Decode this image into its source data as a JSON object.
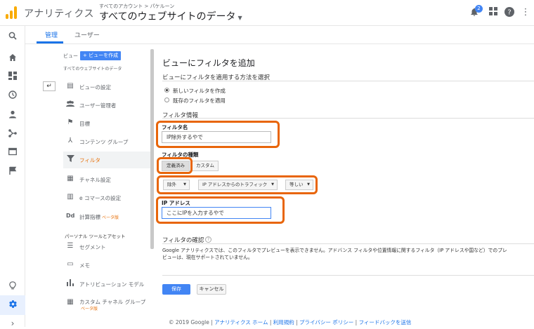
{
  "app": {
    "title": "アナリティクス",
    "breadcrumb": "すべてのアカウント > パケルーン",
    "property": "すべてのウェブサイトのデータ",
    "notification_count": "2"
  },
  "tabs": [
    {
      "label": "管理"
    },
    {
      "label": "ユーザー"
    }
  ],
  "nav": {
    "view_label": "ビュー",
    "create_view": "+ ビューを作成",
    "view_name": "すべてのウェブサイトのデータ",
    "items": [
      {
        "label": "ビューの設定",
        "icon": "document-icon"
      },
      {
        "label": "ユーザー管理者",
        "icon": "users-icon"
      },
      {
        "label": "目標",
        "icon": "flag-icon"
      },
      {
        "label": "コンテンツ グループ",
        "icon": "content-group-icon"
      },
      {
        "label": "フィルタ",
        "icon": "filter-icon"
      },
      {
        "label": "チャネル設定",
        "icon": "channel-icon"
      },
      {
        "label": "e コマースの設定",
        "icon": "cart-icon"
      },
      {
        "label": "計算指標",
        "icon": "dd-icon",
        "badge": "ベータ版"
      },
      {
        "label": "セグメント",
        "icon": "segment-icon"
      },
      {
        "label": "メモ",
        "icon": "memo-icon"
      },
      {
        "label": "アトリビューション モデル",
        "icon": "bar-chart-icon"
      },
      {
        "label": "カスタム チャネル グループ",
        "icon": "custom-channel-icon",
        "badge": "ベータ版"
      }
    ],
    "section_label": "パーソナル ツールとアセット"
  },
  "form": {
    "title": "ビューにフィルタを追加",
    "method_label": "ビューにフィルタを適用する方法を選択",
    "radio_new": "新しいフィルタを作成",
    "radio_existing": "既存のフィルタを適用",
    "info_label": "フィルタ情報",
    "name_label": "フィルタ名",
    "name_value": "IP除外するやで",
    "type_label": "フィルタの種類",
    "type_predefined": "定義済み",
    "type_custom": "カスタム",
    "dd_exclude": "除外",
    "dd_traffic": "IP アドレスからのトラフィック",
    "dd_equal": "等しい",
    "ip_label": "IP アドレス",
    "ip_value": "ここにIPを入力するやで",
    "confirm_label": "フィルタの確認",
    "confirm_text_1": "Google アナリティクスでは、このフィルタでプレビューを表示できません。アドバンス フィルタや位置情報に関するフィルタ（IP アドレスや国など）でのプレ",
    "confirm_text_2": "ビューは、現在サポートされていません。",
    "save": "保存",
    "cancel": "キャンセル"
  },
  "footer": {
    "copyright": "© 2019 Google | ",
    "link_home": "アナリティクス ホーム",
    "sep": " | ",
    "link_terms": "利用規約",
    "link_privacy": "プライバシー ポリシー",
    "link_feedback": "フィードバックを送信"
  },
  "colors": {
    "accent": "#1a73e8",
    "highlight": "#e8650a",
    "active_nav": "#e8710a",
    "primary_button": "#4285f4"
  }
}
